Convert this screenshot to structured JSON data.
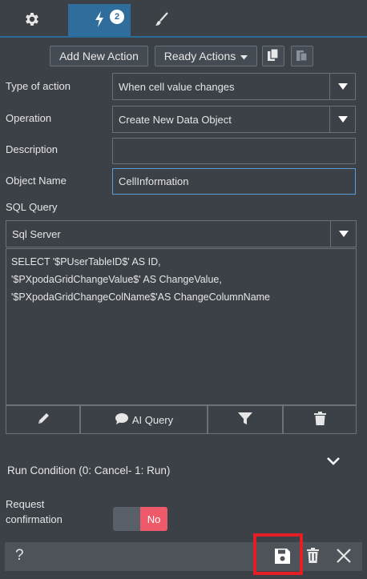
{
  "tabs": {
    "badge_count": "2"
  },
  "toolbar": {
    "add_new_action": "Add New Action",
    "ready_actions": "Ready Actions"
  },
  "form": {
    "type_of_action": {
      "label": "Type of action",
      "value": "When cell value changes"
    },
    "operation": {
      "label": "Operation",
      "value": "Create New Data Object"
    },
    "description": {
      "label": "Description",
      "value": ""
    },
    "object_name": {
      "label": "Object Name",
      "value": "CellInformation"
    },
    "sql_query": {
      "label": "SQL Query",
      "engine": "Sql Server",
      "lines": [
        "SELECT '$PUserTableID$' AS ID,",
        "'$PXpodaGridChangeValue$' AS ChangeValue,",
        "'$PXpodaGridChangeColName$'AS ChangeColumnName"
      ]
    },
    "query_buttons": {
      "ai_query": "AI Query"
    },
    "run_condition": {
      "label": "Run Condition (0: Cancel- 1: Run)"
    },
    "request_confirmation": {
      "label_line1": "Request",
      "label_line2": "confirmation",
      "toggle_value": "No"
    }
  },
  "footer": {
    "help": "?"
  },
  "colors": {
    "accent_tab": "#2f6e9c",
    "toggle_no": "#ef5a6a",
    "highlight": "#e31e24"
  }
}
